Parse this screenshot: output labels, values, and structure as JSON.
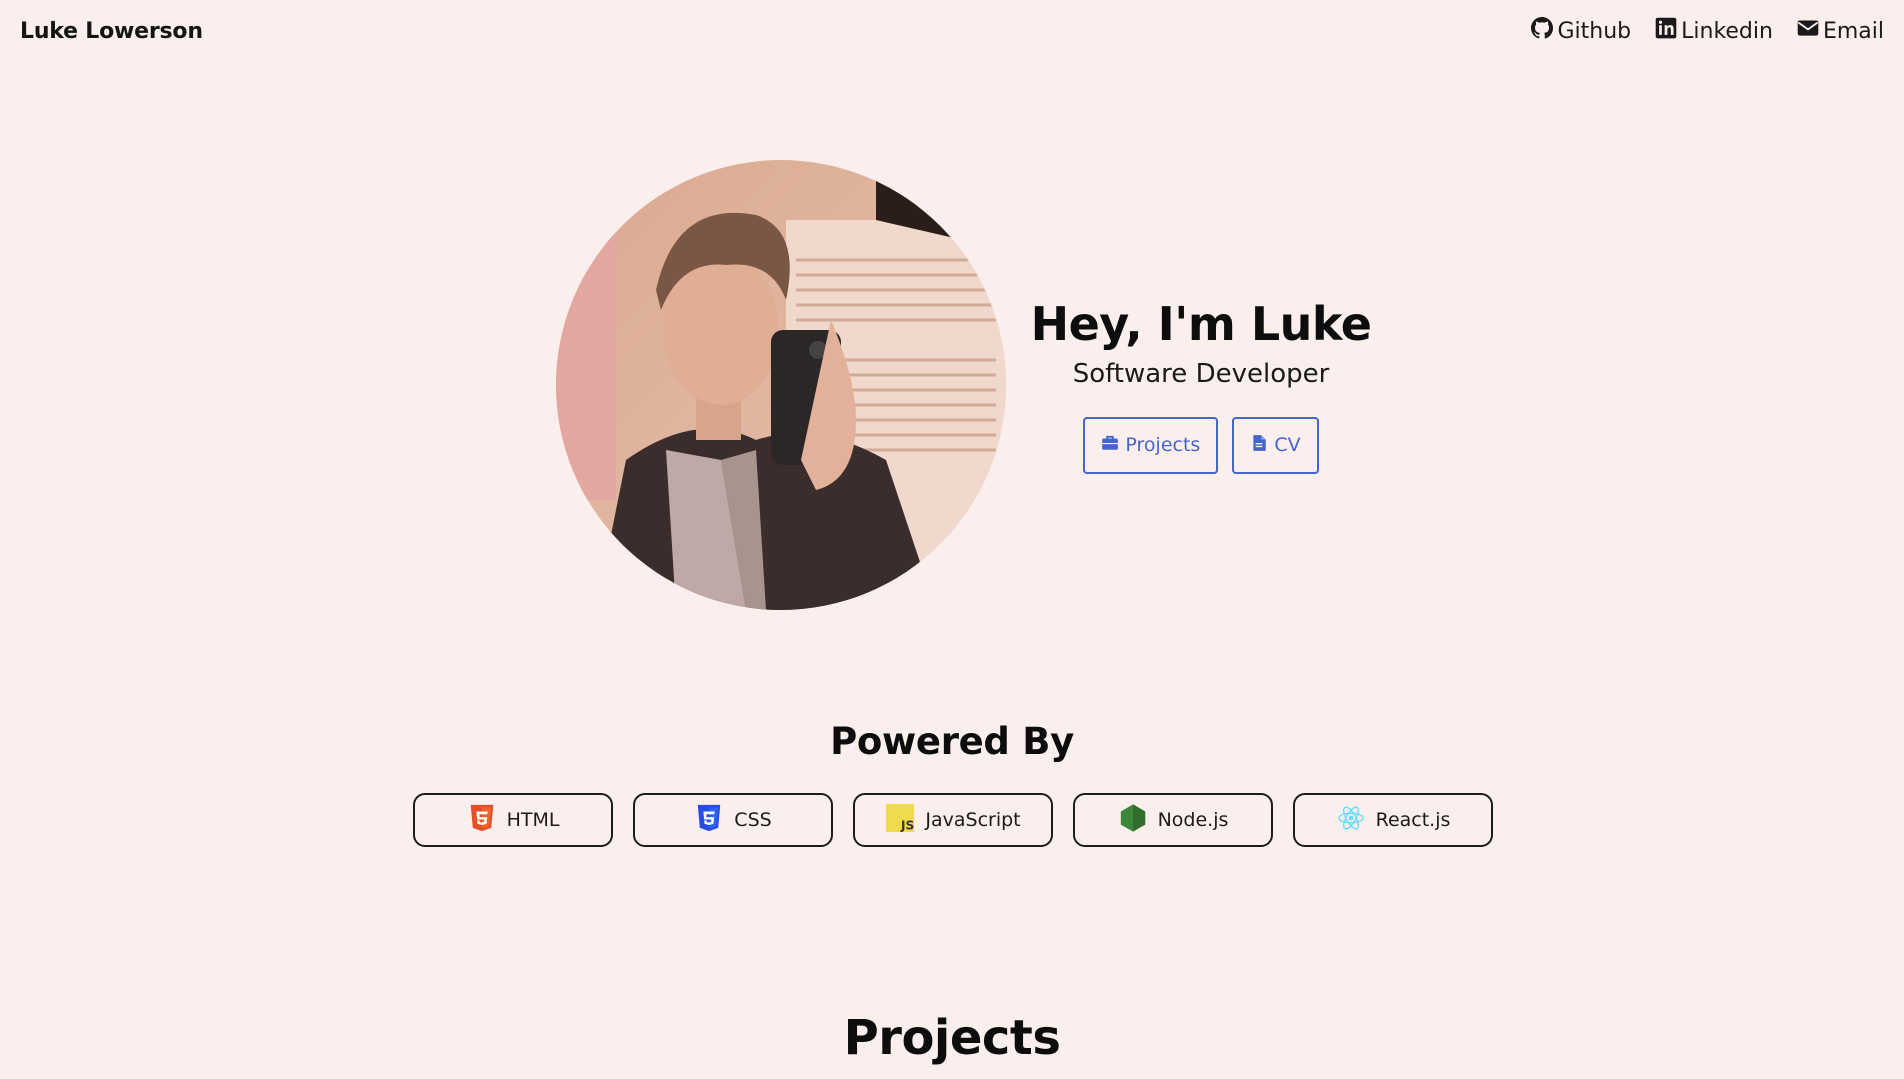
{
  "header": {
    "brand": "Luke Lowerson",
    "links": [
      {
        "label": "Github",
        "icon": "github-icon"
      },
      {
        "label": "Linkedin",
        "icon": "linkedin-icon"
      },
      {
        "label": "Email",
        "icon": "envelope-icon"
      }
    ]
  },
  "hero": {
    "title": "Hey, I'm Luke",
    "subtitle": "Software Developer",
    "buttons": [
      {
        "label": "Projects",
        "icon": "briefcase-icon"
      },
      {
        "label": "CV",
        "icon": "document-icon"
      }
    ]
  },
  "powered": {
    "heading": "Powered By",
    "items": [
      {
        "label": "HTML",
        "icon": "html5-icon"
      },
      {
        "label": "CSS",
        "icon": "css3-icon"
      },
      {
        "label": "JavaScript",
        "icon": "javascript-icon"
      },
      {
        "label": "Node.js",
        "icon": "nodejs-icon"
      },
      {
        "label": "React.js",
        "icon": "react-icon"
      }
    ]
  },
  "projects": {
    "heading": "Projects"
  },
  "colors": {
    "background": "#fbefee",
    "accent": "#4565c8"
  }
}
